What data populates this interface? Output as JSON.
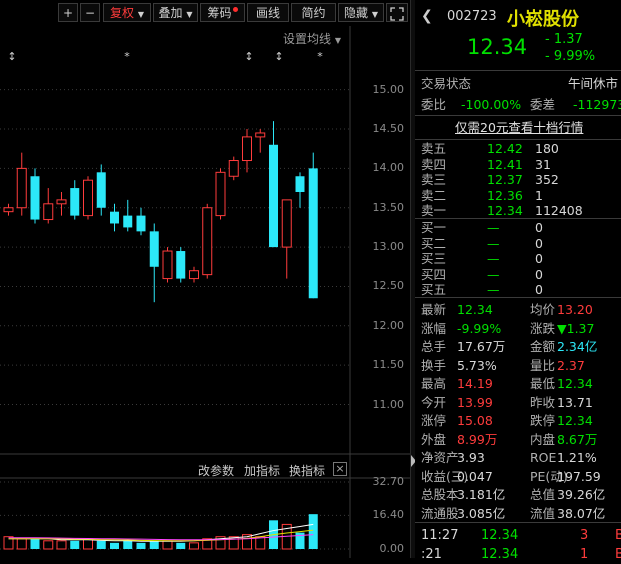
{
  "toolbar": {
    "plus": "+",
    "minus": "−",
    "fuquan": "复权",
    "diejia": "叠加",
    "chouma": "筹码",
    "huaxian": "画线",
    "jianyue": "简约",
    "yincang": "隐藏"
  },
  "chart": {
    "settings_label": "设置均线",
    "price_ticks": [
      "15.00",
      "14.50",
      "14.00",
      "13.50",
      "13.00",
      "12.50",
      "12.00",
      "11.50",
      "11.00"
    ],
    "vol_ticks": [
      "32.70",
      "16.40",
      "0.00"
    ],
    "links": {
      "change_params": "改参数",
      "add_indicator": "加指标",
      "switch_indicator": "换指标"
    },
    "colors": {
      "up": "#ff3c3c",
      "down": "#2ce8f8",
      "ma1": "#ffffff",
      "ma2": "#e0e000",
      "ma3": "#ff44ff"
    },
    "markers": [
      "↕",
      "*",
      "↕",
      "↕",
      "*"
    ]
  },
  "chart_data": {
    "type": "candlestick",
    "ylim": [
      10.6,
      15.25
    ],
    "candles": [
      {
        "o": 13.45,
        "h": 13.55,
        "l": 13.4,
        "c": 13.5
      },
      {
        "o": 13.5,
        "h": 14.2,
        "l": 13.4,
        "c": 14.0
      },
      {
        "o": 13.9,
        "h": 14.0,
        "l": 13.3,
        "c": 13.35
      },
      {
        "o": 13.35,
        "h": 13.75,
        "l": 13.3,
        "c": 13.55
      },
      {
        "o": 13.55,
        "h": 13.7,
        "l": 13.4,
        "c": 13.6
      },
      {
        "o": 13.75,
        "h": 13.85,
        "l": 13.35,
        "c": 13.4
      },
      {
        "o": 13.4,
        "h": 13.9,
        "l": 13.35,
        "c": 13.85
      },
      {
        "o": 13.95,
        "h": 14.05,
        "l": 13.4,
        "c": 13.5
      },
      {
        "o": 13.45,
        "h": 13.55,
        "l": 13.2,
        "c": 13.3
      },
      {
        "o": 13.4,
        "h": 13.6,
        "l": 13.2,
        "c": 13.25
      },
      {
        "o": 13.4,
        "h": 13.5,
        "l": 13.15,
        "c": 13.2
      },
      {
        "o": 13.2,
        "h": 13.3,
        "l": 12.3,
        "c": 12.75
      },
      {
        "o": 12.6,
        "h": 13.0,
        "l": 12.55,
        "c": 12.95
      },
      {
        "o": 12.95,
        "h": 13.0,
        "l": 12.55,
        "c": 12.6
      },
      {
        "o": 12.6,
        "h": 12.75,
        "l": 12.55,
        "c": 12.7
      },
      {
        "o": 12.65,
        "h": 13.55,
        "l": 12.6,
        "c": 13.5
      },
      {
        "o": 13.4,
        "h": 14.0,
        "l": 13.35,
        "c": 13.95
      },
      {
        "o": 13.9,
        "h": 14.15,
        "l": 13.85,
        "c": 14.1
      },
      {
        "o": 14.1,
        "h": 14.5,
        "l": 13.95,
        "c": 14.4
      },
      {
        "o": 14.4,
        "h": 14.5,
        "l": 14.2,
        "c": 14.45
      },
      {
        "o": 14.3,
        "h": 14.6,
        "l": 13.0,
        "c": 13.0
      },
      {
        "o": 13.0,
        "h": 13.6,
        "l": 12.6,
        "c": 13.6
      },
      {
        "o": 13.9,
        "h": 13.95,
        "l": 13.5,
        "c": 13.7
      },
      {
        "o": 14.0,
        "h": 14.2,
        "l": 12.35,
        "c": 12.35
      }
    ],
    "ma": [
      13.55,
      13.6,
      13.6,
      13.58,
      13.56,
      13.55,
      13.54,
      13.52,
      13.5,
      13.45,
      13.38,
      13.28,
      13.18,
      13.08,
      13.0,
      12.95,
      12.98,
      13.05,
      13.15,
      13.3,
      13.45,
      13.5,
      13.52,
      13.45
    ],
    "volume": {
      "ylim": [
        0,
        32.7
      ],
      "values": [
        6,
        5,
        5,
        4,
        4,
        4,
        5,
        4,
        3,
        4,
        3,
        4,
        4,
        3,
        3,
        5,
        6,
        6,
        7,
        6,
        14,
        12,
        8,
        17
      ],
      "ma1": [
        5,
        5,
        5,
        5,
        4.5,
        4.5,
        4.5,
        4.2,
        4,
        4,
        3.8,
        3.8,
        3.8,
        3.8,
        4,
        4.5,
        5,
        5.5,
        6,
        7.5,
        9,
        10,
        11,
        12
      ],
      "ma2": [
        5,
        5,
        5,
        5,
        5,
        4.8,
        4.8,
        4.6,
        4.5,
        4.4,
        4.2,
        4.1,
        4,
        4,
        4,
        4.2,
        4.5,
        4.8,
        5.2,
        6,
        7,
        7.8,
        8.5,
        9.2
      ],
      "ma3": [
        5.5,
        5.5,
        5.5,
        5.4,
        5.3,
        5.2,
        5.1,
        5,
        5,
        4.9,
        4.8,
        4.7,
        4.6,
        4.5,
        4.5,
        4.5,
        4.6,
        4.8,
        5,
        5.4,
        5.8,
        6.2,
        6.6,
        7
      ]
    }
  },
  "stock": {
    "code": "002723",
    "name": "小崧股份",
    "price": "12.34",
    "change": "- 1.37",
    "change_pct": "- 9.99%"
  },
  "status": {
    "label": "交易状态",
    "value": "午间休市"
  },
  "weibi": {
    "label1": "委比",
    "value1": "-100.00%",
    "label2": "委差",
    "value2": "-112973"
  },
  "promo": "仅需20元查看十档行情",
  "asks": [
    {
      "label": "卖五",
      "price": "12.42",
      "vol": "180"
    },
    {
      "label": "卖四",
      "price": "12.41",
      "vol": "31"
    },
    {
      "label": "卖三",
      "price": "12.37",
      "vol": "352"
    },
    {
      "label": "卖二",
      "price": "12.36",
      "vol": "1"
    },
    {
      "label": "卖一",
      "price": "12.34",
      "vol": "112408"
    }
  ],
  "bids": [
    {
      "label": "买一",
      "price": "—",
      "vol": "0"
    },
    {
      "label": "买二",
      "price": "—",
      "vol": "0"
    },
    {
      "label": "买三",
      "price": "—",
      "vol": "0"
    },
    {
      "label": "买四",
      "price": "—",
      "vol": "0"
    },
    {
      "label": "买五",
      "price": "—",
      "vol": "0"
    }
  ],
  "stats": [
    {
      "l1": "最新",
      "v1": "12.34",
      "c1": "g",
      "l2": "均价",
      "v2": "13.20",
      "c2": "r"
    },
    {
      "l1": "涨幅",
      "v1": "-9.99%",
      "c1": "g",
      "l2": "涨跌",
      "v2": "▼1.37",
      "c2": "g"
    },
    {
      "l1": "总手",
      "v1": "17.67万",
      "c1": "w",
      "l2": "金额",
      "v2": "2.34亿",
      "c2": "cy"
    },
    {
      "l1": "换手",
      "v1": "5.73%",
      "c1": "w",
      "l2": "量比",
      "v2": "2.37",
      "c2": "r"
    },
    {
      "l1": "最高",
      "v1": "14.19",
      "c1": "r",
      "l2": "最低",
      "v2": "12.34",
      "c2": "g"
    },
    {
      "l1": "今开",
      "v1": "13.99",
      "c1": "r",
      "l2": "昨收",
      "v2": "13.71",
      "c2": "w"
    },
    {
      "l1": "涨停",
      "v1": "15.08",
      "c1": "r",
      "l2": "跌停",
      "v2": "12.34",
      "c2": "g"
    },
    {
      "l1": "外盘",
      "v1": "8.99万",
      "c1": "r",
      "l2": "内盘",
      "v2": "8.67万",
      "c2": "g"
    },
    {
      "l1": "净资产",
      "v1": "3.93",
      "c1": "w",
      "l2": "ROE",
      "v2": "1.21%",
      "c2": "w"
    },
    {
      "l1": "收益(三)",
      "v1": "0.047",
      "c1": "w",
      "l2": "PE(动)",
      "v2": "197.59",
      "c2": "w"
    },
    {
      "l1": "总股本",
      "v1": "3.181亿",
      "c1": "w",
      "l2": "总值",
      "v2": "39.26亿",
      "c2": "w"
    },
    {
      "l1": "流通股",
      "v1": "3.085亿",
      "c1": "w",
      "l2": "流值",
      "v2": "38.07亿",
      "c2": "w"
    }
  ],
  "ticks": [
    {
      "time": "11:27",
      "price": "12.34",
      "vol": "3",
      "arrow": "B"
    },
    {
      "time": ":21",
      "price": "12.34",
      "vol": "1",
      "arrow": "B"
    }
  ]
}
